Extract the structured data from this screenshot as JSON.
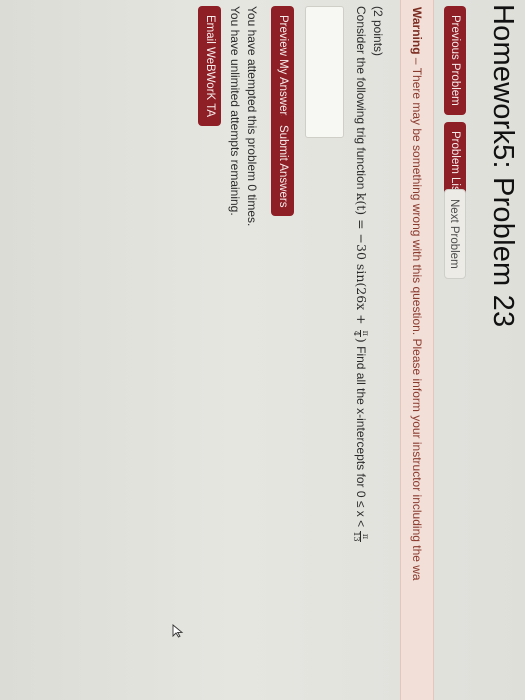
{
  "title": "Homework5: Problem 23",
  "nav": {
    "previous": "Previous Problem",
    "list": "Problem List",
    "next": "Next Problem"
  },
  "warning": {
    "label": "Warning",
    "message": " – There may be something wrong with this question. Please inform your instructor including the wa"
  },
  "problem": {
    "points": "(2 points)",
    "text_before": "Consider the following trig function ",
    "function": "k(t) = −30 sin(26x + ",
    "func_frac_num": "π",
    "func_frac_den": "4",
    "func_close": ")",
    "text_after": " Find all the x-intercepts for 0 ≤ x < ",
    "range_frac_num": "π",
    "range_frac_den": "13"
  },
  "buttons": {
    "preview": "Preview My Answers",
    "submit": "Submit Answers",
    "email": "Email WeBWorK TA"
  },
  "attempts": {
    "line1": "You have attempted this problem 0 times.",
    "line2": "You have unlimited attempts remaining."
  },
  "colors": {
    "accent": "#8e1f26",
    "warning_bg": "#f2dfd8",
    "warning_text": "#8b3a2e"
  }
}
